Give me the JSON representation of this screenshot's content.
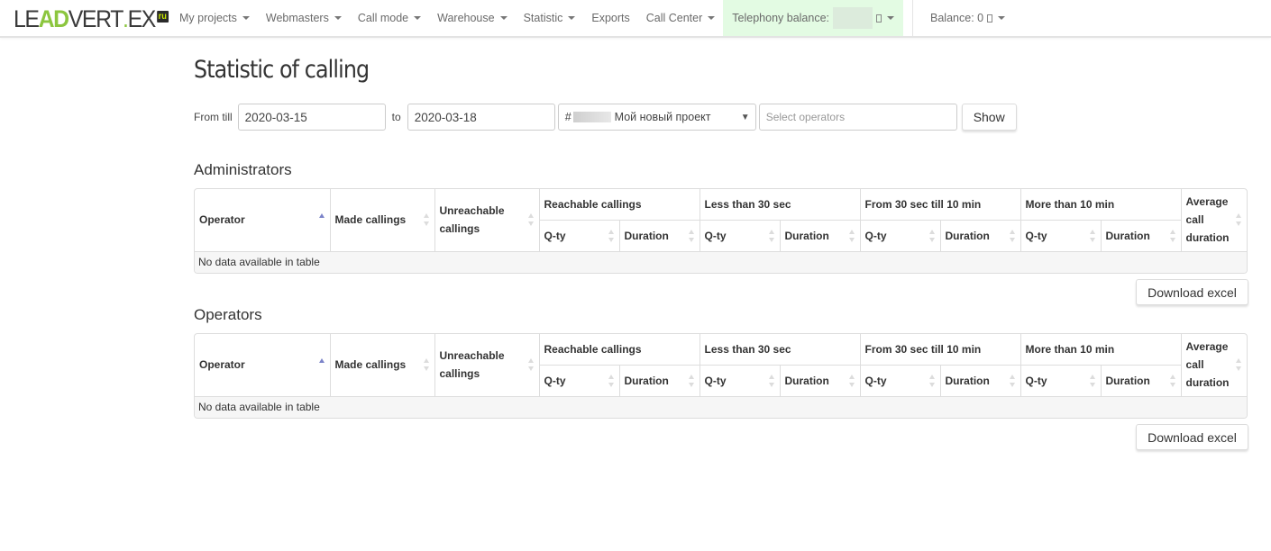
{
  "navbar": {
    "logo": {
      "le": "LE",
      "ad": "AD",
      "vert": "VERT",
      "dot": ".",
      "ex": "EX",
      "ru": "ru"
    },
    "items": [
      {
        "label": "My projects",
        "has_dropdown": true
      },
      {
        "label": "Webmasters",
        "has_dropdown": true
      },
      {
        "label": "Call mode",
        "has_dropdown": true
      },
      {
        "label": "Warehouse",
        "has_dropdown": true
      },
      {
        "label": "Statistic",
        "has_dropdown": true
      },
      {
        "label": "Exports",
        "has_dropdown": false
      },
      {
        "label": "Call Center",
        "has_dropdown": true
      }
    ],
    "telephony_balance": {
      "label": "Telephony balance:",
      "value": "",
      "currency_glyph": "□",
      "highlight_color": "#e3fbe3"
    },
    "balance": {
      "label": "Balance: 0",
      "currency_glyph": "□"
    }
  },
  "page": {
    "title": "Statistic of calling",
    "filters": {
      "from_label": "From till",
      "from_value": "2020-03-15",
      "to_label": "to",
      "to_value": "2020-03-18",
      "project_prefix": "#",
      "project_name": "Мой новый проект",
      "operators_placeholder": "Select operators",
      "show_button": "Show"
    }
  },
  "columns": {
    "operator": "Operator",
    "made": "Made callings",
    "unreachable": "Unreachable callings",
    "groups": [
      "Reachable callings",
      "Less than 30 sec",
      "From 30 sec till 10 min",
      "More than 10 min"
    ],
    "qty": "Q-ty",
    "duration": "Duration",
    "avg": "Average call duration"
  },
  "tables": [
    {
      "title": "Administrators",
      "empty_text": "No data available in table",
      "download_label": "Download excel",
      "rows": []
    },
    {
      "title": "Operators",
      "empty_text": "No data available in table",
      "download_label": "Download excel",
      "rows": []
    }
  ],
  "colors": {
    "accent_green": "#8cc63f",
    "sort_active": "#7b83c9"
  }
}
